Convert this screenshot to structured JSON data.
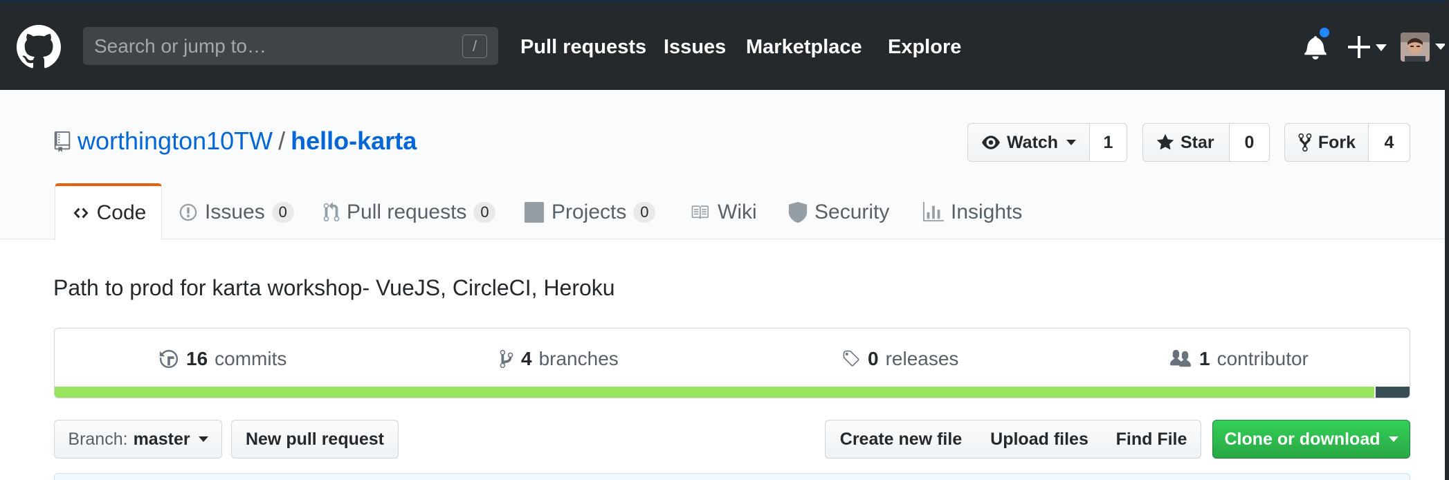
{
  "header": {
    "search_placeholder": "Search or jump to…",
    "search_shortcut": "/",
    "nav": [
      {
        "label": "Pull requests"
      },
      {
        "label": "Issues"
      },
      {
        "label": "Marketplace"
      },
      {
        "label": "Explore"
      }
    ],
    "notification_color": "#2188ff",
    "background": "#24292e"
  },
  "repo": {
    "owner": "worthington10TW",
    "separator": "/",
    "name": "hello-karta",
    "watch": {
      "label": "Watch",
      "count": "1"
    },
    "star": {
      "label": "Star",
      "count": "0"
    },
    "fork": {
      "label": "Fork",
      "count": "4"
    },
    "description": "Path to prod for karta workshop- VueJS, CircleCI, Heroku"
  },
  "tabs": [
    {
      "label": "Code",
      "icon": "code-icon",
      "selected": true
    },
    {
      "label": "Issues",
      "count": "0",
      "icon": "issue-icon"
    },
    {
      "label": "Pull requests",
      "count": "0",
      "icon": "pull-request-icon"
    },
    {
      "label": "Projects",
      "count": "0",
      "icon": "project-icon"
    },
    {
      "label": "Wiki",
      "icon": "book-icon"
    },
    {
      "label": "Security",
      "icon": "shield-icon"
    },
    {
      "label": "Insights",
      "icon": "graph-icon"
    }
  ],
  "summary": {
    "commits": {
      "count": "16",
      "label": "commits"
    },
    "branches": {
      "count": "4",
      "label": "branches"
    },
    "releases": {
      "count": "0",
      "label": "releases"
    },
    "contributors": {
      "count": "1",
      "label": "contributor"
    },
    "languages": [
      {
        "color": "#9be45f",
        "percent": 97.4
      },
      {
        "color": "#384d54",
        "percent": 2.6
      }
    ]
  },
  "file_nav": {
    "branch_prefix": "Branch:",
    "branch_name": "master",
    "new_pull_request": "New pull request",
    "create_new_file": "Create new file",
    "upload_files": "Upload files",
    "find_file": "Find File",
    "clone_or_download": "Clone or download"
  }
}
